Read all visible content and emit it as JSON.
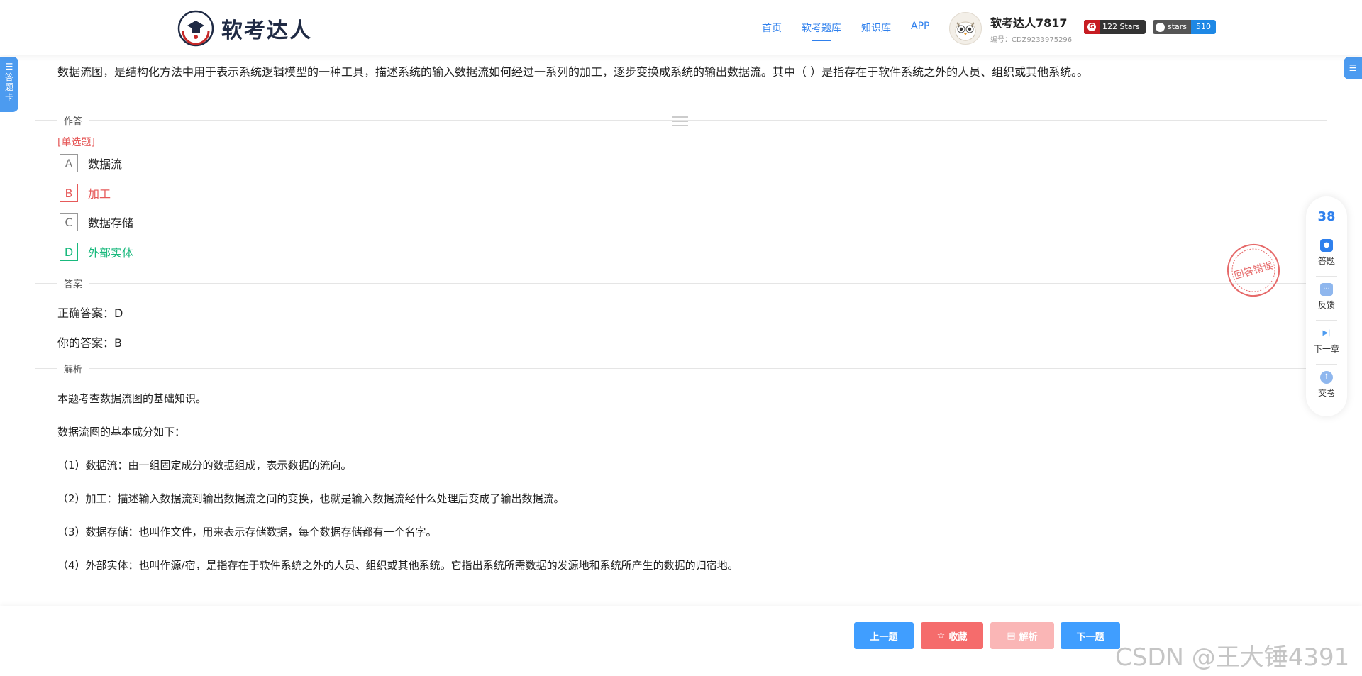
{
  "header": {
    "logo_text": "软考达人",
    "nav": [
      "首页",
      "软考题库",
      "知识库",
      "APP"
    ],
    "active_nav": "软考题库",
    "user_name": "软考达人7817",
    "user_id": "编号：CDZ9233975296",
    "gitee_badge": "122 Stars",
    "github_label": "stars",
    "github_count": "510"
  },
  "left_tab": {
    "label": "答题卡"
  },
  "question": {
    "text": "数据流图，是结构化方法中用于表示系统逻辑模型的一种工具，描述系统的输入数据流如何经过一系列的加工，逐步变换成系统的输出数据流。其中（ ）是指存在于软件系统之外的人员、组织或其他系统。。",
    "answer_section": "作答",
    "type_label": "[单选题]",
    "options": [
      {
        "letter": "A",
        "text": "数据流",
        "state": "normal"
      },
      {
        "letter": "B",
        "text": "加工",
        "state": "wrong"
      },
      {
        "letter": "C",
        "text": "数据存储",
        "state": "normal"
      },
      {
        "letter": "D",
        "text": "外部实体",
        "state": "correct"
      }
    ]
  },
  "answer": {
    "section": "答案",
    "correct": "正确答案：D",
    "yours": "你的答案：B",
    "stamp": "回答错误"
  },
  "analysis": {
    "section": "解析",
    "paragraphs": [
      "本题考查数据流图的基础知识。",
      "数据流图的基本成分如下：",
      "（1）数据流：由一组固定成分的数据组成，表示数据的流向。",
      "（2）加工：描述输入数据流到输出数据流之间的变换，也就是输入数据流经什么处理后变成了输出数据流。",
      "（3）数据存储：也叫作文件，用来表示存储数据，每个数据存储都有一个名字。",
      "（4）外部实体：也叫作源/宿，是指存在于软件系统之外的人员、组织或其他系统。它指出系统所需数据的发源地和系统所产生的数据的归宿地。"
    ]
  },
  "float_panel": {
    "count": "38",
    "items": [
      "答题",
      "反馈",
      "下一章",
      "交卷"
    ]
  },
  "bottom": {
    "prev": "上一题",
    "favorite": "收藏",
    "analysis": "解析",
    "next": "下一题",
    "watermark": "CSDN @王大锤4391"
  },
  "colors": {
    "accent": "#409eff",
    "wrong": "#e65a5a",
    "correct": "#19b97d"
  }
}
